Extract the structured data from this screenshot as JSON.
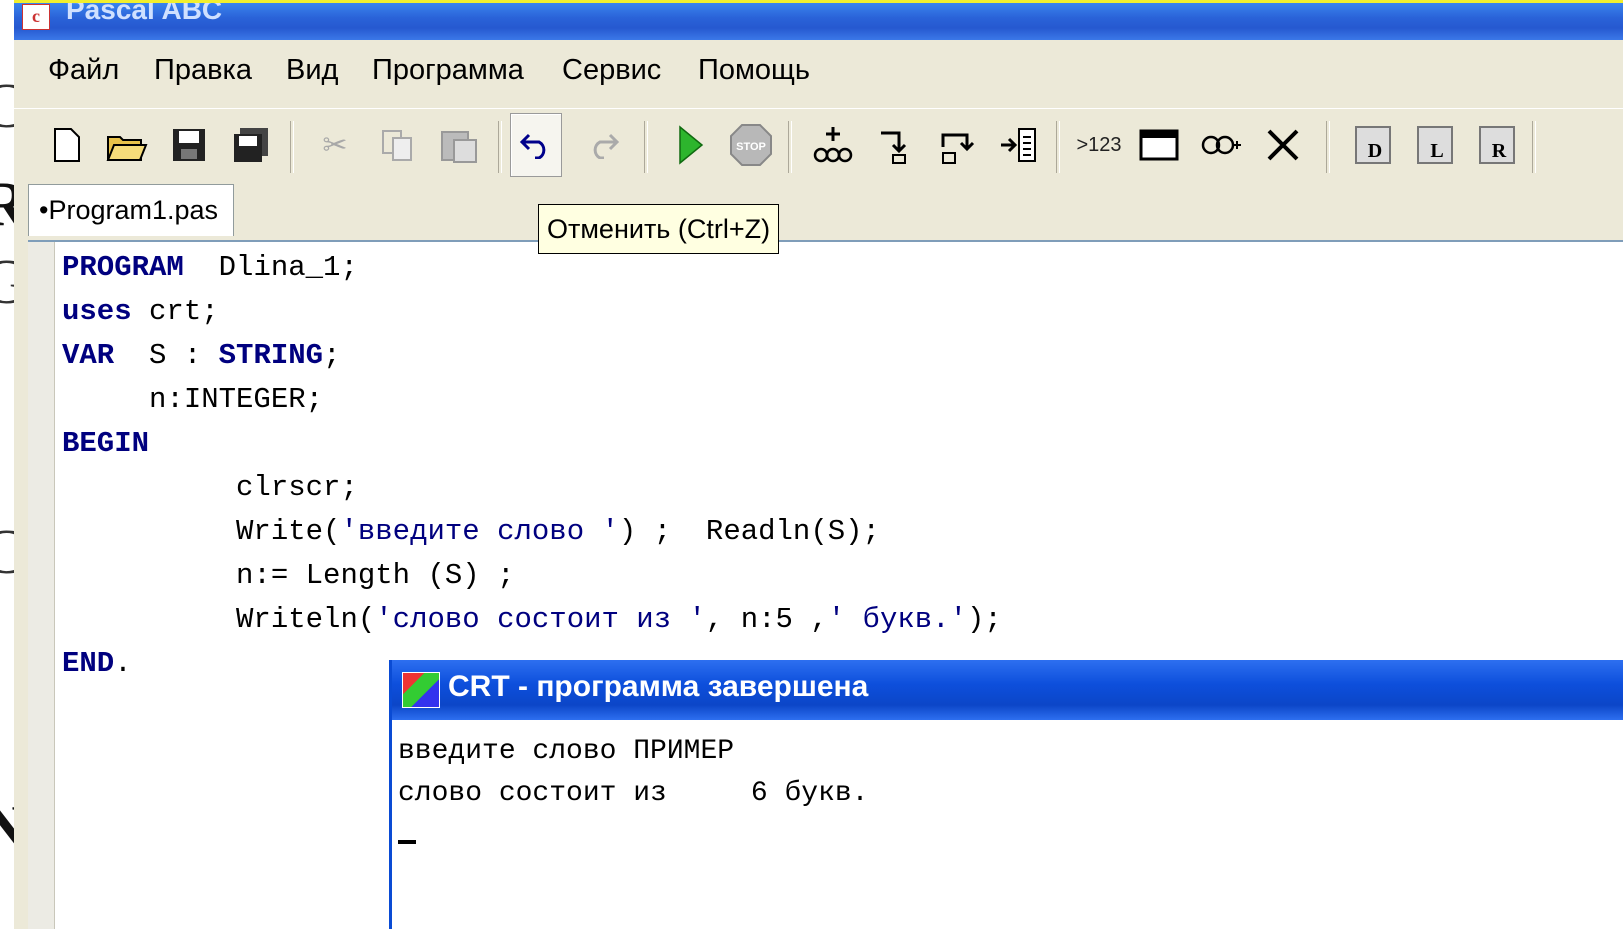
{
  "window": {
    "title": "Pascal ABC"
  },
  "menu": [
    "Файл",
    "Правка",
    "Вид",
    "Программа",
    "Сервис",
    "Помощь"
  ],
  "toolbar": {
    "output_label": ">123",
    "icons": [
      "new-file-icon",
      "open-folder-icon",
      "save-icon",
      "save-all-icon",
      "cut-icon",
      "copy-icon",
      "paste-icon",
      "undo-icon",
      "redo-icon",
      "run-icon",
      "stop-icon",
      "add-watch-icon",
      "step-into-icon",
      "step-over-icon",
      "run-to-cursor-icon",
      "output-icon",
      "window-icon",
      "watch-icon",
      "close-icon",
      "run-d-icon",
      "run-l-icon",
      "run-r-icon"
    ]
  },
  "tab": {
    "label": "•Program1.pas"
  },
  "tooltip": {
    "text": "Отменить (Ctrl+Z)"
  },
  "code": {
    "l1_kw": "PROGRAM",
    "l1_rest": "  Dlina_1;",
    "l2_kw": "uses",
    "l2_rest": " crt;",
    "l3_kw": "VAR",
    "l3_mid": "  S : ",
    "l3_kw2": "STRING",
    "l3_end": ";",
    "l4": "     n:INTEGER;",
    "l5_kw": "BEGIN",
    "l6": "          clrscr;",
    "l7_a": "          Write(",
    "l7_str": "'введите слово '",
    "l7_b": ") ;  Readln(S);",
    "l8": "          n:= Length (S) ;",
    "l9_a": "          Writeln(",
    "l9_str1": "'слово состоит из '",
    "l9_b": ", n:5 ,",
    "l9_str2": "' букв.'",
    "l9_c": ");",
    "l10_kw": "END",
    "l10_rest": "."
  },
  "crt": {
    "title": "CRT - программа завершена",
    "line1": "введите слово ПРИМЕР",
    "line2": "слово состоит из     6 букв."
  },
  "colors": {
    "keyword": "#00007f",
    "titlebar": "#2659d0",
    "crt_titlebar": "#0d4fdc",
    "toolbar_bg": "#ece9d8"
  }
}
